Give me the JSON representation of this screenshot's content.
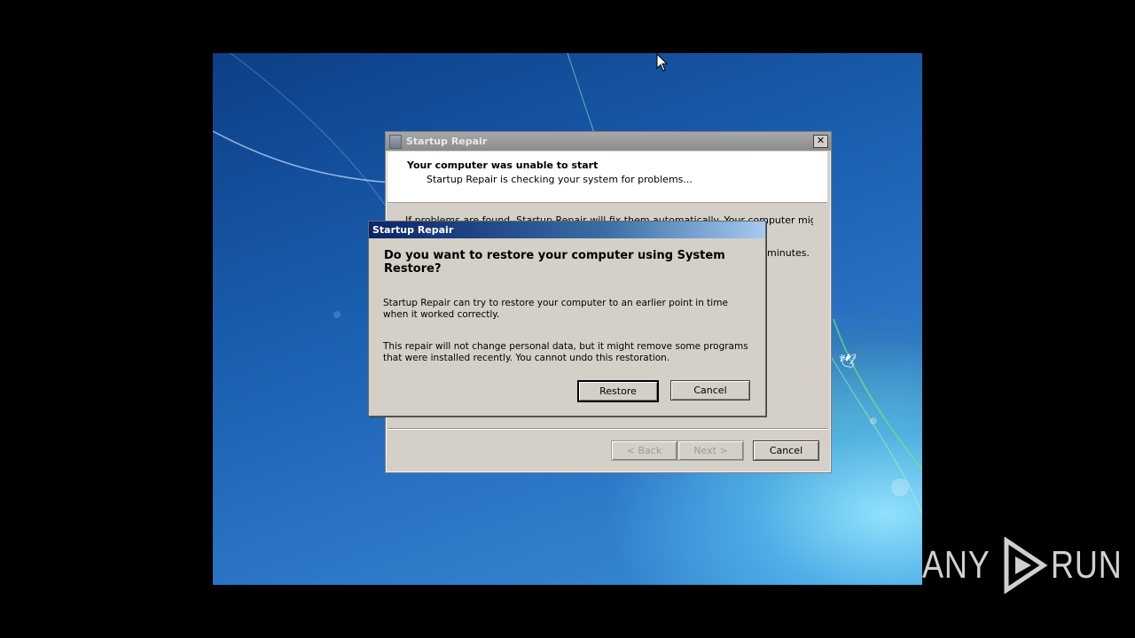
{
  "back_window": {
    "title": "Startup Repair",
    "header_title": "Your computer was unable to start",
    "header_subtitle": "Startup Repair is checking your system for problems...",
    "body_line1": "If problems are found, Startup Repair will fix them automatically. Your computer might restart",
    "body_line2": "l minutes.",
    "close_label": "✕",
    "buttons": {
      "back": "< Back",
      "next": "Next >",
      "cancel": "Cancel"
    }
  },
  "dialog": {
    "title": "Startup Repair",
    "question": "Do you want to restore your computer using System Restore?",
    "paragraph1": "Startup Repair can try to restore your computer to an earlier point in time when it worked correctly.",
    "paragraph2": "This repair will not change personal data, but it might remove some programs that were installed recently. You cannot undo this restoration.",
    "buttons": {
      "restore": "Restore",
      "cancel": "Cancel"
    }
  },
  "watermark": {
    "left": "ANY",
    "right": "RUN"
  },
  "colors": {
    "dialog_titlebar": "#0a246a",
    "window_face": "#d4d0c8"
  }
}
